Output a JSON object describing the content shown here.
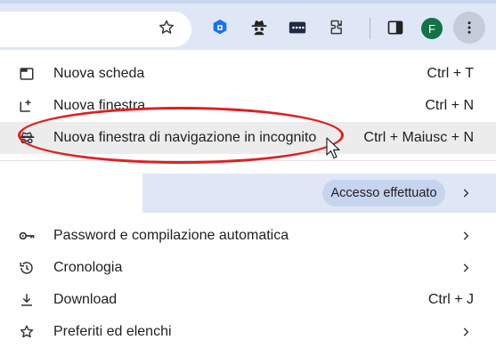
{
  "toolbar": {
    "icons": [
      "star-icon",
      "extension-blue-icon",
      "incognito-spy-icon",
      "password-dots-icon",
      "puzzle-extensions-icon",
      "side-panel-icon"
    ],
    "avatar_letter": "F",
    "menu_icon": "three-dots-vertical-icon"
  },
  "menu": {
    "items": [
      {
        "label": "Nuova scheda",
        "shortcut": "Ctrl + T",
        "icon": "new-tab-icon"
      },
      {
        "label": "Nuova finestra",
        "shortcut": "Ctrl + N",
        "icon": "new-window-icon"
      },
      {
        "label": "Nuova finestra di navigazione in incognito",
        "shortcut": "Ctrl + Maiusc + N",
        "icon": "incognito-icon"
      }
    ],
    "profile": {
      "status": "Accesso effettuato"
    },
    "items2": [
      {
        "label": "Password e compilazione automatica",
        "shortcut": "",
        "icon": "key-icon"
      },
      {
        "label": "Cronologia",
        "shortcut": "",
        "icon": "history-icon"
      },
      {
        "label": "Download",
        "shortcut": "Ctrl + J",
        "icon": "download-icon"
      },
      {
        "label": "Preferiti ed elenchi",
        "shortcut": "",
        "icon": "bookmark-star-icon"
      }
    ]
  },
  "colors": {
    "toolbar_bg": "#dfe7f6",
    "highlight_row": "#ececec",
    "annotation_red": "#e02020",
    "avatar_green": "#137247"
  }
}
